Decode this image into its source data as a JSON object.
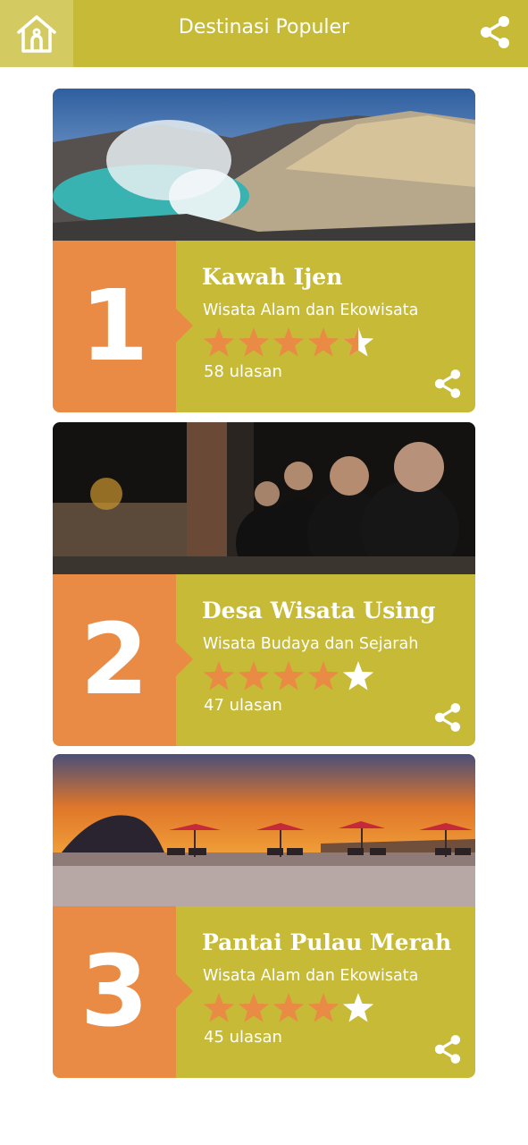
{
  "header": {
    "title": "Destinasi Populer",
    "home_icon": "home-icon",
    "share_icon": "share-icon"
  },
  "colors": {
    "header_bg": "#c6ba36",
    "accent_orange": "#e98b44",
    "star_filled": "#e98b44",
    "star_empty": "#ffffff"
  },
  "destinations": [
    {
      "rank": "1",
      "name": "Kawah Ijen",
      "category": "Wisata Alam dan Ekowisata",
      "rating": 4.5,
      "reviews": "58 ulasan",
      "photo": "volcano-crater-lake"
    },
    {
      "rank": "2",
      "name": "Desa Wisata Using",
      "category": "Wisata Budaya dan Sejarah",
      "rating": 4,
      "reviews": "47 ulasan",
      "photo": "village-elders-night"
    },
    {
      "rank": "3",
      "name": "Pantai Pulau Merah",
      "category": "Wisata Alam dan Ekowisata",
      "rating": 4,
      "reviews": "45 ulasan",
      "photo": "beach-sunset-umbrellas"
    }
  ]
}
